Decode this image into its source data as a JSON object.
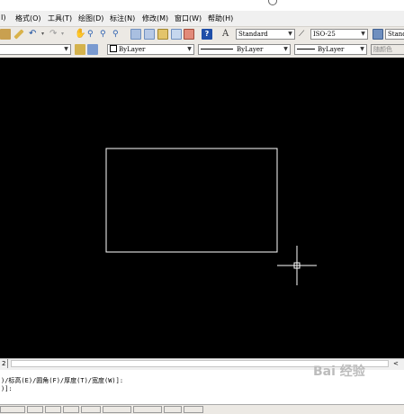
{
  "menu": {
    "items": [
      "I)",
      "格式(O)",
      "工具(T)",
      "绘图(D)",
      "标注(N)",
      "修改(M)",
      "窗口(W)",
      "帮助(H)"
    ]
  },
  "toolbar": {
    "text_style": "Standard",
    "dim_style": "ISO-25",
    "table_style_partial": "Stand"
  },
  "properties": {
    "color": "ByLayer",
    "linetype": "ByLayer",
    "lineweight": "ByLayer",
    "plotstyle": "随颜色"
  },
  "tabs": {
    "partial_tab": "2"
  },
  "command": {
    "line1": ")/标高(E)/圆角(F)/厚度(T)/宽度(W)]:",
    "line2": ")]:"
  },
  "watermark": "Bai 经验",
  "colors": {
    "canvas_bg": "#000000",
    "rectangle_stroke": "#ffffff",
    "crosshair": "#ffffff"
  }
}
